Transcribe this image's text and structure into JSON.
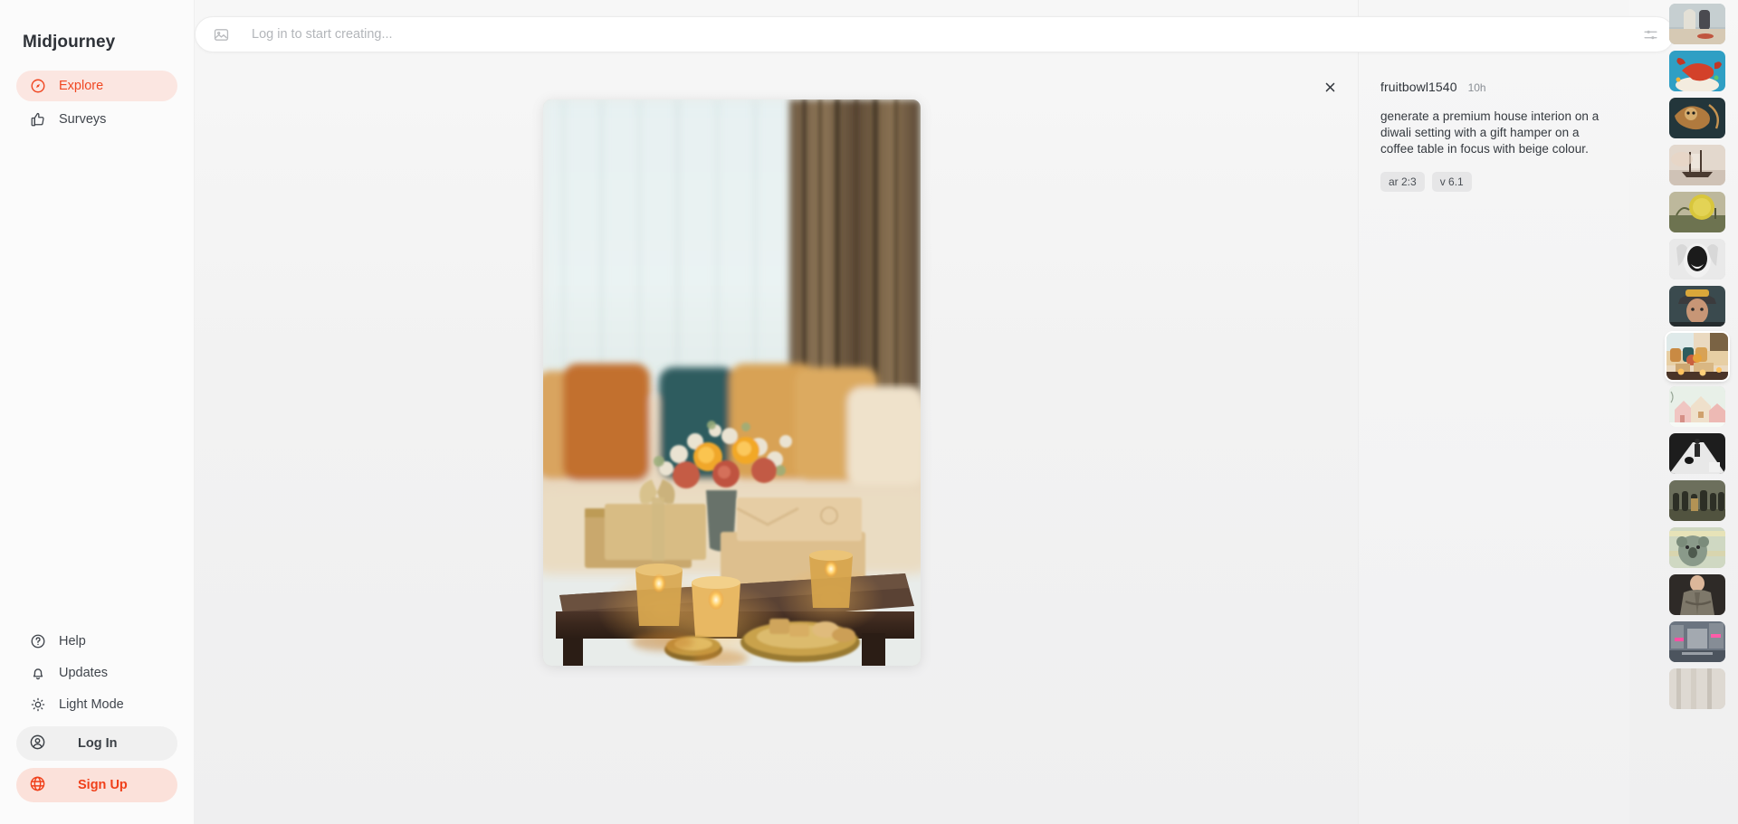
{
  "sidebar": {
    "brand": "Midjourney",
    "nav_top": [
      {
        "label": "Explore",
        "icon": "compass-icon",
        "active": true
      },
      {
        "label": "Surveys",
        "icon": "thumbs-up-icon",
        "active": false
      }
    ],
    "nav_bottom": [
      {
        "label": "Help",
        "icon": "question-circle-icon"
      },
      {
        "label": "Updates",
        "icon": "bell-icon"
      },
      {
        "label": "Light Mode",
        "icon": "sun-icon"
      }
    ],
    "login_label": "Log In",
    "login_icon": "user-circle-icon",
    "signup_label": "Sign Up",
    "signup_icon": "globe-icon"
  },
  "prompt_bar": {
    "placeholder": "Log in to start creating...",
    "value": "",
    "left_icon": "image-icon",
    "right_icon": "settings-sliders-icon"
  },
  "viewer": {
    "close_icon": "close-icon",
    "image_alt": "diwali-living-room-gift-hamper"
  },
  "info": {
    "author": "fruitbowl1540",
    "time": "10h",
    "prompt": "generate a premium house interion on a diwali setting with a gift hamper on a coffee table in focus with beige colour.",
    "tags": [
      "ar 2:3",
      "v 6.1"
    ]
  },
  "rail": {
    "thumbs": [
      {
        "name": "desert-figures",
        "selected": false
      },
      {
        "name": "lobster-splash",
        "selected": false
      },
      {
        "name": "owl-flight",
        "selected": false
      },
      {
        "name": "sailing-ship",
        "selected": false
      },
      {
        "name": "yellow-sphere-tree",
        "selected": false
      },
      {
        "name": "bw-portrait-ink",
        "selected": false
      },
      {
        "name": "firefighter-portrait",
        "selected": false
      },
      {
        "name": "diwali-living-room",
        "selected": true
      },
      {
        "name": "snow-village-houses",
        "selected": false
      },
      {
        "name": "bw-girl-dog-path",
        "selected": false
      },
      {
        "name": "crowd-figures-field",
        "selected": false
      },
      {
        "name": "koala-supermarket",
        "selected": false
      },
      {
        "name": "fashion-model-coat",
        "selected": false
      },
      {
        "name": "neon-city-street",
        "selected": false
      },
      {
        "name": "pale-texture",
        "selected": false
      }
    ]
  },
  "colors": {
    "accent": "#f0401a",
    "accent_soft": "#fbe1da",
    "text": "#33383e",
    "muted": "#8a8f95"
  }
}
